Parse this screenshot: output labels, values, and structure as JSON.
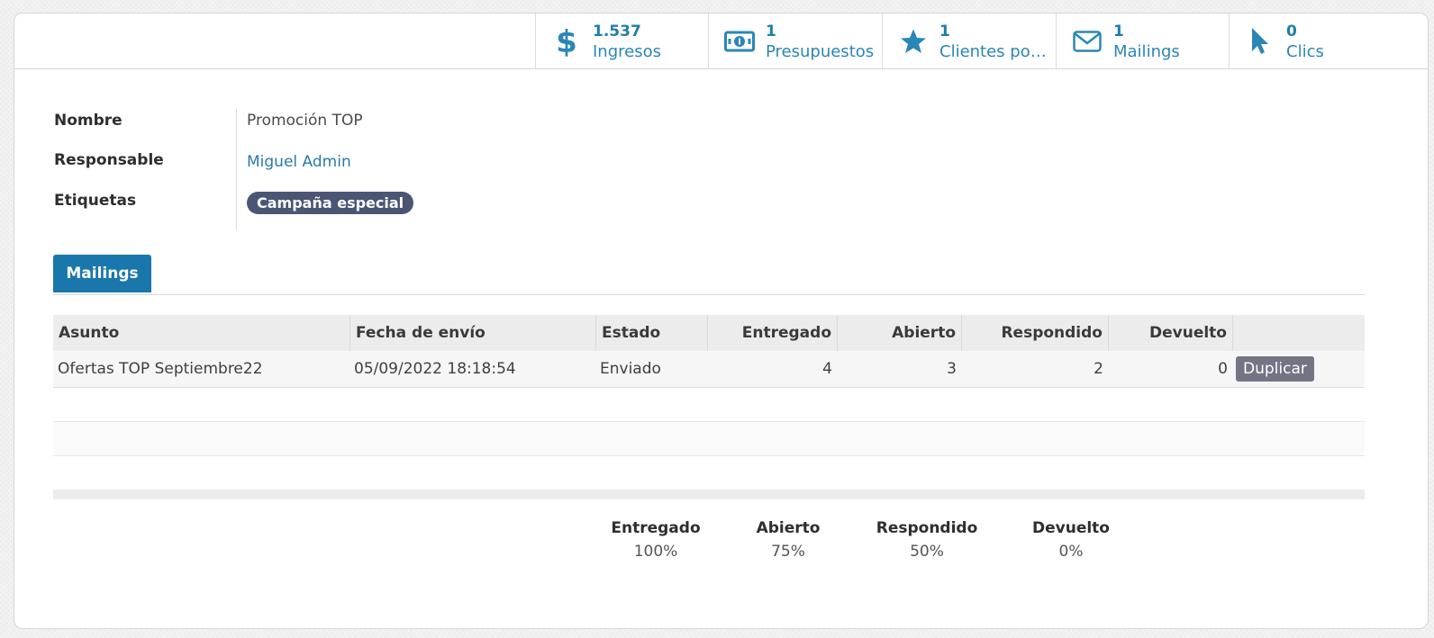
{
  "colors": {
    "accent": "#1a77ab",
    "smart_button_text": "#1f7dab",
    "tag_background": "#4b5675",
    "duplicate_button": "#737584"
  },
  "smart_buttons": [
    {
      "icon": "dollar-icon",
      "value": "1.537",
      "label": "Ingresos"
    },
    {
      "icon": "money-bill-icon",
      "value": "1",
      "label": "Presupuestos"
    },
    {
      "icon": "star-icon",
      "value": "1",
      "label": "Clientes pot..."
    },
    {
      "icon": "envelope-icon",
      "value": "1",
      "label": "Mailings"
    },
    {
      "icon": "pointer-icon",
      "value": "0",
      "label": "Clics"
    }
  ],
  "fields": {
    "name": {
      "label": "Nombre",
      "value": "Promoción TOP"
    },
    "responsible": {
      "label": "Responsable",
      "value": "Miguel Admin"
    },
    "tags": {
      "label": "Etiquetas",
      "items": [
        "Campaña especial"
      ]
    }
  },
  "tabs": [
    {
      "label": "Mailings",
      "active": true
    }
  ],
  "table": {
    "columns": [
      "Asunto",
      "Fecha de envío",
      "Estado",
      "Entregado",
      "Abierto",
      "Respondido",
      "Devuelto"
    ],
    "rows": [
      {
        "subject": "Ofertas TOP Septiembre22",
        "send_date": "05/09/2022 18:18:54",
        "state": "Enviado",
        "delivered": "4",
        "opened": "3",
        "replied": "2",
        "bounced": "0",
        "action_label": "Duplicar"
      }
    ]
  },
  "stats": [
    {
      "label": "Entregado",
      "value": "100%"
    },
    {
      "label": "Abierto",
      "value": "75%"
    },
    {
      "label": "Respondido",
      "value": "50%"
    },
    {
      "label": "Devuelto",
      "value": "0%"
    }
  ]
}
